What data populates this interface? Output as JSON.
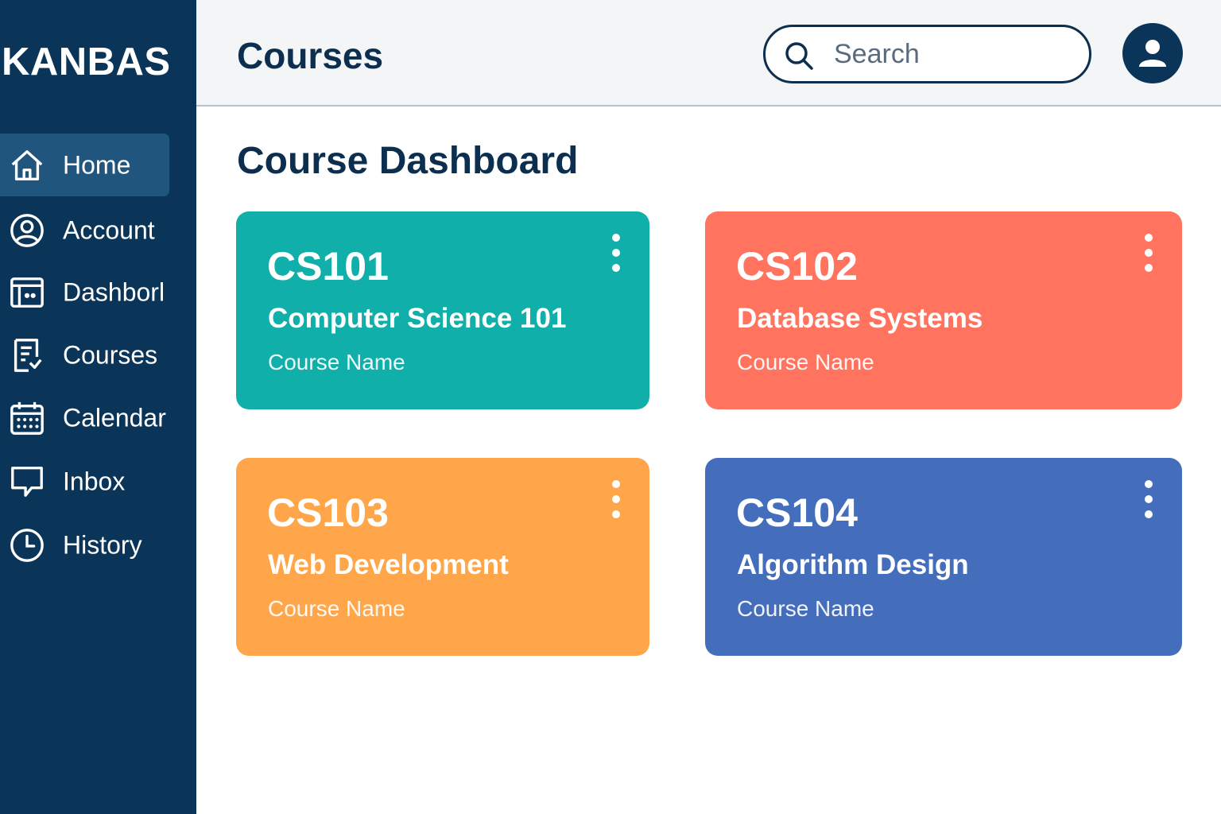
{
  "app": {
    "brand": "KANBAS"
  },
  "sidebar": {
    "items": [
      {
        "label": "Home",
        "icon": "home-icon",
        "active": true
      },
      {
        "label": "Account",
        "icon": "account-icon",
        "active": false
      },
      {
        "label": "Dashborl",
        "icon": "dashboard-icon",
        "active": false
      },
      {
        "label": "Courses",
        "icon": "courses-icon",
        "active": false
      },
      {
        "label": "Calendar",
        "icon": "calendar-icon",
        "active": false
      },
      {
        "label": "Inbox",
        "icon": "inbox-icon",
        "active": false
      },
      {
        "label": "History",
        "icon": "history-icon",
        "active": false
      }
    ]
  },
  "header": {
    "title": "Courses",
    "search": {
      "placeholder": "Search",
      "value": ""
    },
    "avatar_icon": "user-icon"
  },
  "main": {
    "title": "Course Dashboard",
    "cards": [
      {
        "code": "CS101",
        "title": "Computer Science 101",
        "subtitle": "Course Name",
        "color": "#11afa9"
      },
      {
        "code": "CS102",
        "title": "Database Systems",
        "subtitle": "Course Name",
        "color": "#ff735f"
      },
      {
        "code": "CS103",
        "title": "Web Development",
        "subtitle": "Course Name",
        "color": "#ffa64b"
      },
      {
        "code": "CS104",
        "title": "Algorithm Design",
        "subtitle": "Course Name",
        "color": "#446ebb"
      }
    ]
  },
  "colors": {
    "sidebar": "#0b3558",
    "sidebar_active": "#20557e",
    "header_bg": "#f3f5f7",
    "text_dark": "#0d2f4f"
  }
}
